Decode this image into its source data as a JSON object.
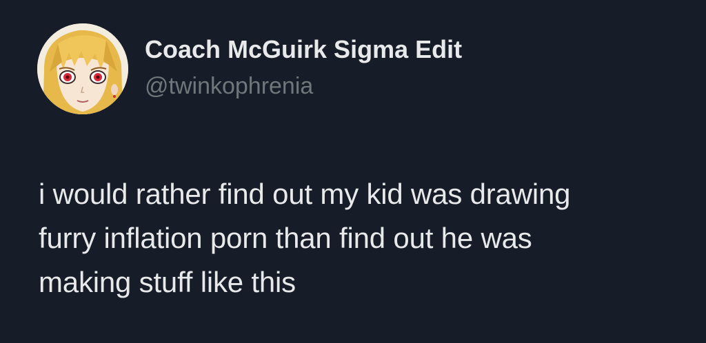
{
  "author": {
    "display_name": "Coach McGuirk Sigma Edit",
    "handle": "@twinkophrenia",
    "avatar_icon": "anime-character-avatar"
  },
  "tweet": {
    "lines": [
      "i would rather find out my kid was drawing",
      "furry inflation porn than find out he was",
      "making stuff like this"
    ]
  },
  "colors": {
    "background": "#161c28",
    "text": "#e7e9ea",
    "handle": "#71767b"
  }
}
